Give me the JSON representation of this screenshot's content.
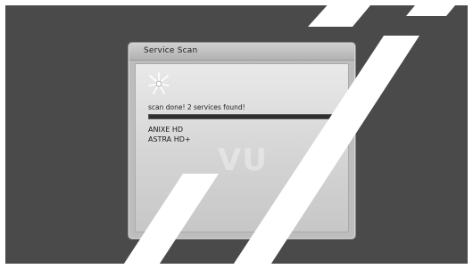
{
  "dialog": {
    "title": "Service Scan",
    "status": "scan done! 2 services found!",
    "progress": 1.0,
    "scan_icon": "satellite-dish-icon",
    "services": [
      {
        "name": "ANIXE HD"
      },
      {
        "name": "ASTRA HD+"
      }
    ]
  },
  "colors": {
    "screen_bg": "#4a4a4a",
    "dialog_bg": "#bdbdbd",
    "progress_fill": "#2f2f2f",
    "watermark": "#ffffff"
  }
}
